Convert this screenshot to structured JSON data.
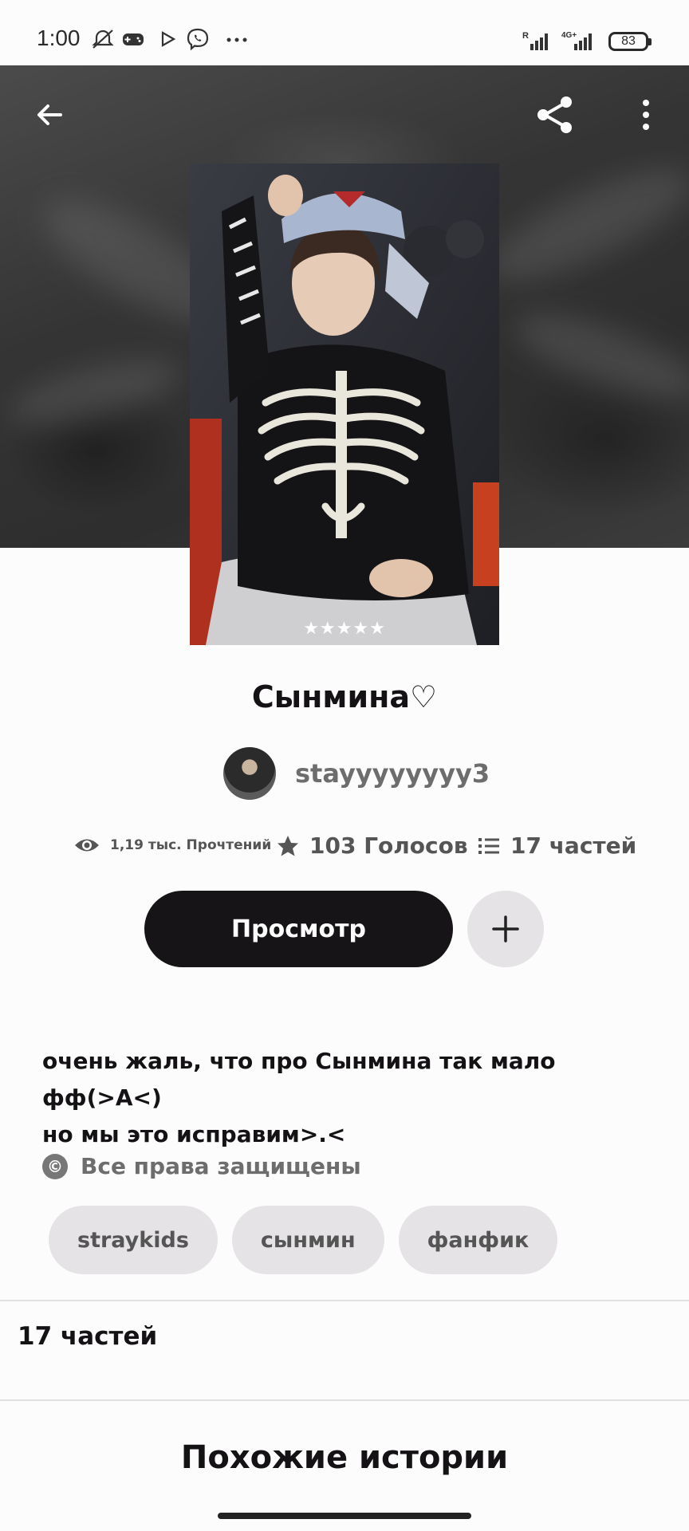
{
  "status_bar": {
    "time": "1:00",
    "battery": "83",
    "network_type": "4G+",
    "roaming": "R",
    "icons": [
      "mute-bell-icon",
      "gamepad-icon",
      "play-store-icon",
      "viber-icon",
      "more-dots-icon"
    ]
  },
  "header": {
    "back_icon": "arrow-left-icon",
    "share_icon": "share-icon",
    "menu_icon": "more-vertical-icon"
  },
  "cover": {
    "stars": "★★★★★"
  },
  "story": {
    "title": "Сынмина♡",
    "author": "stayyyyyyyy3",
    "stats": {
      "reads": "1,19 тыс. Прочтений",
      "votes": "103 Голосов",
      "parts": "17 частей"
    },
    "read_button": "Просмотр",
    "description_line1": "очень жаль, что про Сынмина так мало фф(>A<)",
    "description_line2": "но мы это исправим>.<",
    "copyright": "Все права защищены",
    "tags": [
      "straykids",
      "сынмин",
      "фанфик"
    ]
  },
  "parts_section": {
    "title": "17 частей"
  },
  "similar": {
    "title": "Похожие истории"
  },
  "colors": {
    "primary_button": "#161416",
    "chip_bg": "#e5e3e6",
    "muted_text": "#6d6d6d"
  }
}
